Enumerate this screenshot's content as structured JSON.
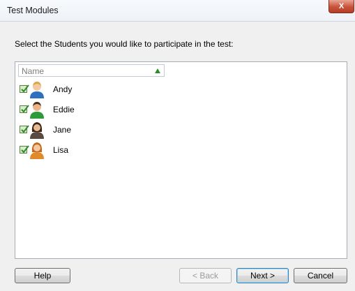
{
  "window": {
    "title": "Test Modules",
    "close_label": "X"
  },
  "instruction": "Select the Students you would like to participate in the test:",
  "list": {
    "column_header": "Name",
    "sort": "ascending",
    "students": [
      {
        "name": "Andy",
        "checked": true,
        "avatar": "male-blue-avatar"
      },
      {
        "name": "Eddie",
        "checked": true,
        "avatar": "male-green-avatar"
      },
      {
        "name": "Jane",
        "checked": true,
        "avatar": "female-dark-avatar"
      },
      {
        "name": "Lisa",
        "checked": true,
        "avatar": "female-orange-avatar"
      }
    ]
  },
  "buttons": {
    "help": "Help",
    "back": "< Back",
    "next": "Next >",
    "cancel": "Cancel"
  },
  "colors": {
    "check_green": "#2e8b2e",
    "close_red": "#c7533b",
    "default_button": "#3c7fb1"
  }
}
